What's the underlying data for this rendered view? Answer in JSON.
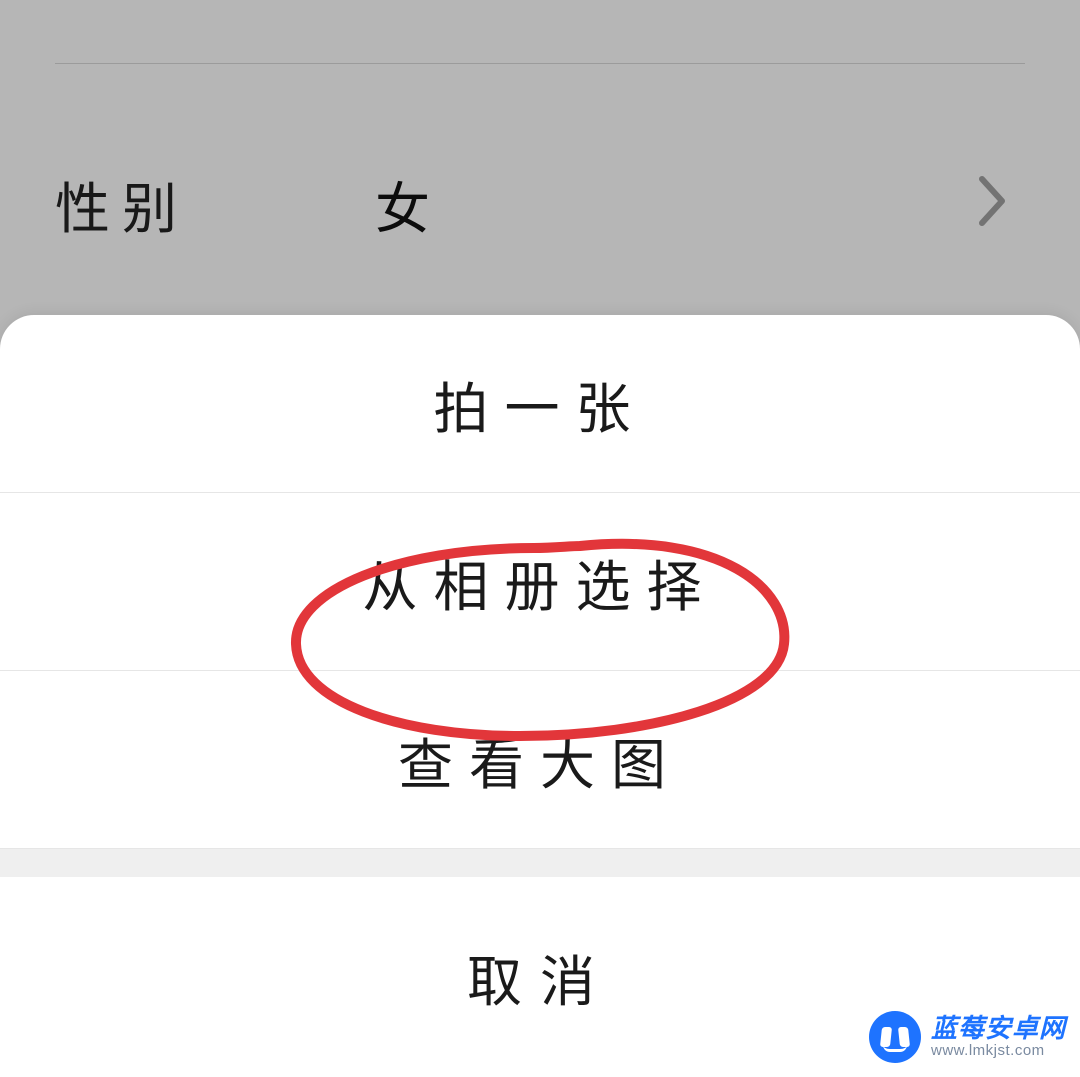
{
  "background": {
    "rows": [
      {
        "label": "性别",
        "value": "女"
      }
    ]
  },
  "sheet": {
    "options": [
      "拍一张",
      "从相册选择",
      "查看大图"
    ],
    "cancel": "取消"
  },
  "watermark": {
    "title": "蓝莓安卓网",
    "url": "www.lmkjst.com"
  }
}
